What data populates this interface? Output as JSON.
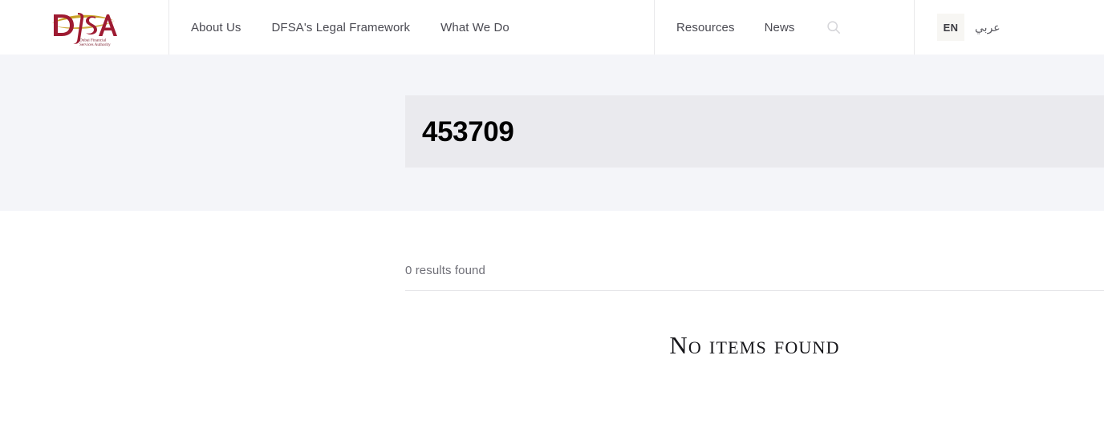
{
  "header": {
    "logo": {
      "name": "dfsa-logo",
      "wordmark": "DFSA",
      "subtitle_line1": "Dubai Financial",
      "subtitle_line2": "Services Authority",
      "mark_color": "#9e1b32",
      "swoosh_color": "#c9a227"
    },
    "primary_nav": [
      {
        "label": "About Us"
      },
      {
        "label": "DFSA's Legal Framework"
      },
      {
        "label": "What We Do"
      }
    ],
    "secondary_nav": [
      {
        "label": "Resources"
      },
      {
        "label": "News"
      }
    ],
    "search": {
      "icon": "search-icon"
    },
    "language": {
      "active_label": "EN",
      "alternate_label": "عربي",
      "active_background": "#f7f6f3"
    }
  },
  "hero": {
    "title": "453709",
    "background": "#f4f5f9",
    "title_box_background": "#eaeaee"
  },
  "results": {
    "count_text": "0 results found",
    "empty_state_text": "No items found"
  }
}
